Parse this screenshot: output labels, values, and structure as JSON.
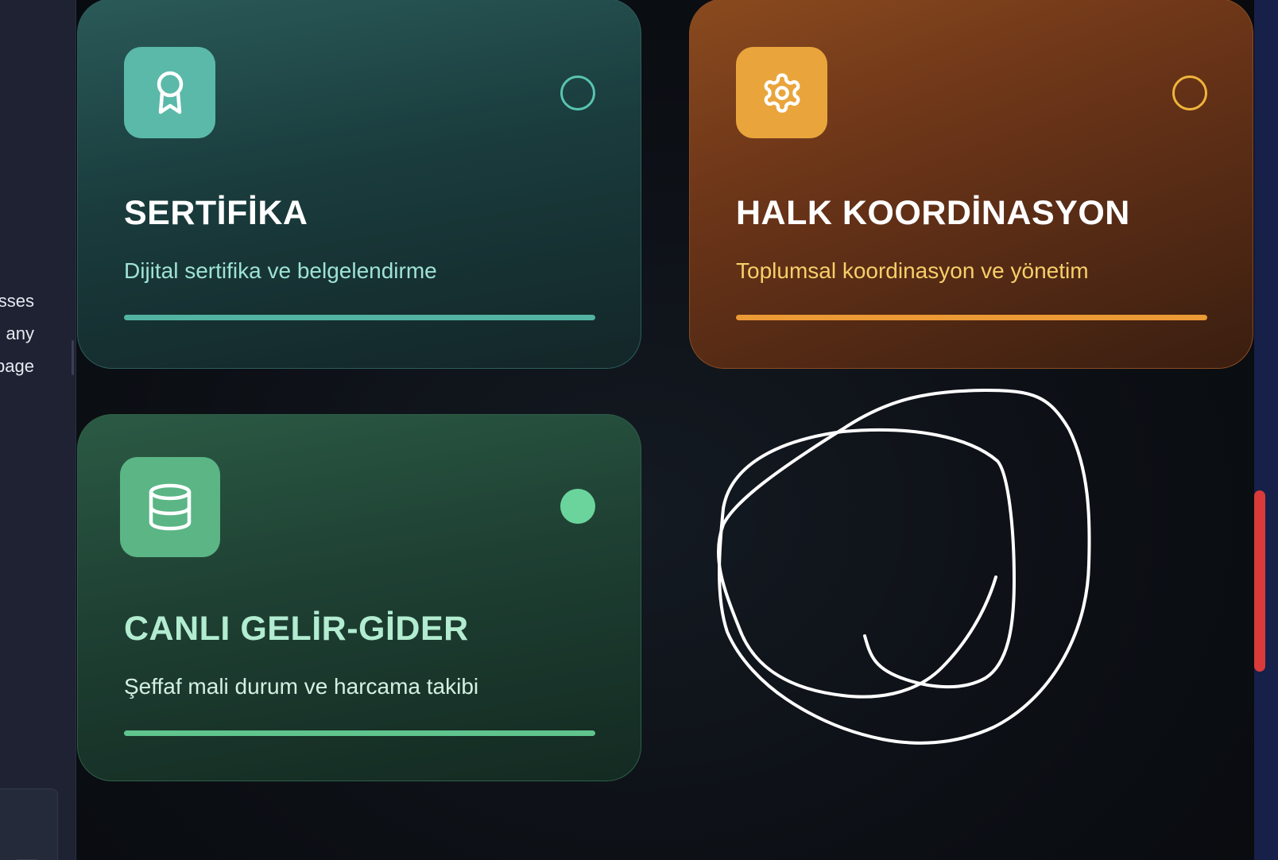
{
  "sidebar": {
    "text_lines": [
      "sses",
      "any",
      "page"
    ]
  },
  "cards": [
    {
      "title": "SERTİFİKA",
      "description": "Dijital sertifika ve belgelendirme",
      "icon": "award-icon",
      "status": "inactive",
      "accent": "#5bb9a9"
    },
    {
      "title": "HALK KOORDİNASYON",
      "description": "Toplumsal koordinasyon ve yönetim",
      "icon": "gear-icon",
      "status": "inactive",
      "accent": "#e9a53c"
    },
    {
      "title": "CANLI GELİR-GİDER",
      "description": "Şeffaf mali durum ve harcama takibi",
      "icon": "database-icon",
      "status": "active",
      "accent": "#5bb585"
    }
  ],
  "scrollbar": {
    "color": "#d93a3a"
  }
}
